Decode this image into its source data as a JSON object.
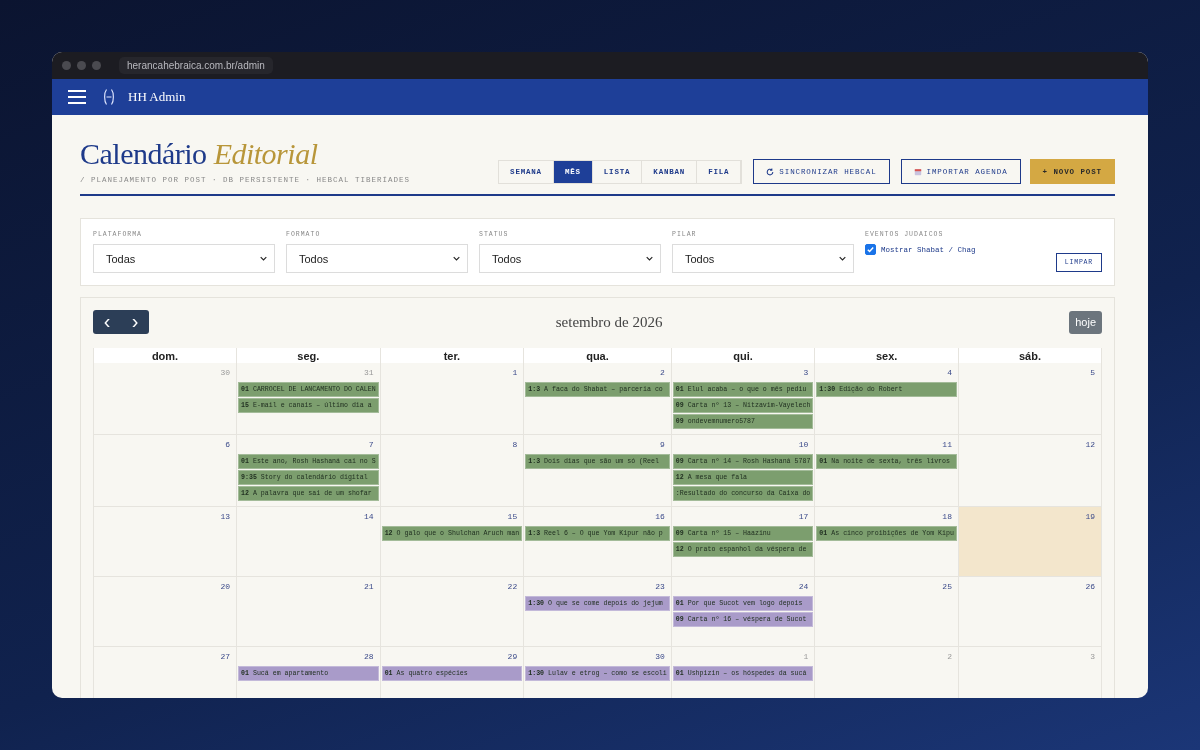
{
  "browser": {
    "address": "herancahebraica.com.br/admin"
  },
  "topbar": {
    "title": "HH Admin"
  },
  "header": {
    "title": "Calendário *Editorial*",
    "subtitle": "/ PLANEJAMENTO POR POST · DB PERSISTENTE · HEBCAL TIBERÍADES"
  },
  "view_tabs": [
    {
      "label": "SEMANA",
      "selected": false
    },
    {
      "label": "MÊS",
      "selected": true
    },
    {
      "label": "LISTA",
      "selected": false
    },
    {
      "label": "KANBAN",
      "selected": false
    },
    {
      "label": "FILA",
      "selected": false
    }
  ],
  "actions": [
    {
      "kind": "sync",
      "label": "SINCRONIZAR HEBCAL"
    },
    {
      "kind": "import",
      "label": "IMPORTAR AGENDA"
    },
    {
      "kind": "primary",
      "label": "+ NOVO POST"
    }
  ],
  "filters": [
    {
      "label": "PLATAFORMA",
      "value": "Todas"
    },
    {
      "label": "FORMATO",
      "value": "Todos"
    },
    {
      "label": "STATUS",
      "value": "Todos"
    },
    {
      "label": "PILAR",
      "value": "Todos"
    }
  ],
  "jewish_events": {
    "label": "EVENTOS JUDAICOS",
    "option": "Mostrar Shabat / Chag",
    "checked": true,
    "clear": "LIMPAR"
  },
  "calendar": {
    "month": "setembro de 2026",
    "prev": "‹",
    "next": "›",
    "today_button": "hoje",
    "weekdays": [
      "dom.",
      "seg.",
      "ter.",
      "qua.",
      "qui.",
      "sex.",
      "sáb."
    ],
    "weeks": [
      {
        "days": [
          {
            "num": "30",
            "other_month": true,
            "today": false
          },
          {
            "num": "31",
            "other_month": true,
            "today": false,
            "events": [
              {
                "time": "01",
                "title": "CARROCEL DE LANCAMENTO DO CALEN",
                "color": "#7c9e6e"
              },
              {
                "time": "15",
                "title": "E-mail e canais – último dia a",
                "color": "#7c9e6e"
              }
            ]
          },
          {
            "num": "1",
            "other_month": false,
            "today": false
          },
          {
            "num": "2",
            "other_month": false,
            "today": false,
            "events": [
              {
                "time": "1:3",
                "title": "A faca do Shabat – parceria co",
                "color": "#7c9e6e"
              }
            ]
          },
          {
            "num": "3",
            "other_month": false,
            "today": false,
            "events": [
              {
                "time": "01",
                "title": "Elul acaba – o que o mês pediu",
                "color": "#7c9e6e"
              },
              {
                "time": "09",
                "title": "Carta nº 13 – Nitzavim-Vayelech",
                "color": "#7c9e6e"
              },
              {
                "time": "09",
                "title": "ondevemnumero5787",
                "color": "#7c9e6e"
              }
            ]
          },
          {
            "num": "4",
            "other_month": false,
            "today": false,
            "events": [
              {
                "time": "1:30",
                "title": "Edição do Robert",
                "color": "#7c9e6e"
              }
            ]
          },
          {
            "num": "5",
            "other_month": false,
            "today": false
          }
        ]
      },
      {
        "days": [
          {
            "num": "6",
            "other_month": false,
            "today": false
          },
          {
            "num": "7",
            "other_month": false,
            "today": false,
            "events": [
              {
                "time": "01",
                "title": "Este ano, Rosh Hashaná cai no S",
                "color": "#7c9e6e"
              },
              {
                "time": "9:35",
                "title": "Story do calendário digital",
                "color": "#7c9e6e"
              },
              {
                "time": "12",
                "title": "A palavra que sai de um shofar",
                "color": "#7c9e6e"
              }
            ]
          },
          {
            "num": "8",
            "other_month": false,
            "today": false
          },
          {
            "num": "9",
            "other_month": false,
            "today": false,
            "events": [
              {
                "time": "1:3",
                "title": "Dois dias que são um só (Reel",
                "color": "#7c9e6e"
              }
            ]
          },
          {
            "num": "10",
            "other_month": false,
            "today": false,
            "events": [
              {
                "time": "09",
                "title": "Carta nº 14 – Rosh Hashaná 5787",
                "color": "#7c9e6e"
              },
              {
                "time": "12",
                "title": "A mesa que fala",
                "color": "#7c9e6e"
              },
              {
                "title": ":Resultado do concurso da Caixa do",
                "color": "#7c9e6e"
              }
            ]
          },
          {
            "num": "11",
            "other_month": false,
            "today": false,
            "events": [
              {
                "time": "01",
                "title": "Na noite de sexta, três livros",
                "color": "#7c9e6e"
              }
            ]
          },
          {
            "num": "12",
            "other_month": false,
            "today": false
          }
        ]
      },
      {
        "days": [
          {
            "num": "13",
            "other_month": false,
            "today": false
          },
          {
            "num": "14",
            "other_month": false,
            "today": false
          },
          {
            "num": "15",
            "other_month": false,
            "today": false,
            "events": [
              {
                "time": "12",
                "title": "O galo que o Shulchan Aruch man",
                "color": "#7c9e6e"
              }
            ]
          },
          {
            "num": "16",
            "other_month": false,
            "today": false,
            "events": [
              {
                "time": "1:3",
                "title": "Reel 6 – O que Yom Kipur não p",
                "color": "#7c9e6e"
              }
            ]
          },
          {
            "num": "17",
            "other_month": false,
            "today": false,
            "events": [
              {
                "time": "09",
                "title": "Carta nº 15 – Haazinu",
                "color": "#7c9e6e"
              },
              {
                "time": "12",
                "title": "O prato espanhol da véspera de",
                "color": "#7c9e6e"
              }
            ]
          },
          {
            "num": "18",
            "other_month": false,
            "today": false,
            "events": [
              {
                "time": "01",
                "title": "As cinco proibições de Yom Kipu",
                "color": "#7c9e6e"
              }
            ]
          },
          {
            "num": "19",
            "other_month": false,
            "today": true
          }
        ]
      },
      {
        "days": [
          {
            "num": "20",
            "other_month": false,
            "today": false
          },
          {
            "num": "21",
            "other_month": false,
            "today": false
          },
          {
            "num": "22",
            "other_month": false,
            "today": false
          },
          {
            "num": "23",
            "other_month": false,
            "today": false,
            "events": [
              {
                "time": "1:30",
                "title": "O que se come depois do jejum",
                "color": "#a99bc9"
              }
            ]
          },
          {
            "num": "24",
            "other_month": false,
            "today": false,
            "events": [
              {
                "time": "01",
                "title": "Por que Sucot vem logo depois",
                "color": "#a99bc9"
              },
              {
                "time": "09",
                "title": "Carta nº 16 – véspera de Sucot",
                "color": "#a99bc9"
              }
            ]
          },
          {
            "num": "25",
            "other_month": false,
            "today": false
          },
          {
            "num": "26",
            "other_month": false,
            "today": false
          }
        ]
      },
      {
        "days": [
          {
            "num": "27",
            "other_month": false,
            "today": false
          },
          {
            "num": "28",
            "other_month": false,
            "today": false,
            "events": [
              {
                "time": "01",
                "title": "Sucá em apartamento",
                "color": "#a99bc9"
              }
            ]
          },
          {
            "num": "29",
            "other_month": false,
            "today": false,
            "events": [
              {
                "time": "01",
                "title": "As quatro espécies",
                "color": "#a99bc9"
              }
            ]
          },
          {
            "num": "30",
            "other_month": false,
            "today": false,
            "events": [
              {
                "time": "1:30",
                "title": "Lulav e etrog – como se escoli",
                "color": "#a99bc9"
              }
            ]
          },
          {
            "num": "1",
            "other_month": true,
            "today": false,
            "events": [
              {
                "time": "01",
                "title": "Ushpizin – os hóspedes da sucá",
                "color": "#a99bc9"
              }
            ]
          },
          {
            "num": "2",
            "other_month": true,
            "today": false
          },
          {
            "num": "3",
            "other_month": true,
            "today": false
          }
        ]
      }
    ]
  }
}
